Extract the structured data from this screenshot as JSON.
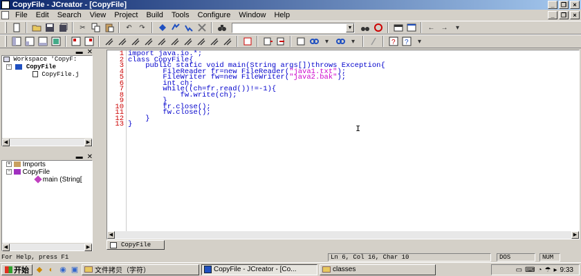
{
  "window": {
    "title": "CopyFile - JCreator - [CopyFile]"
  },
  "menu": [
    "File",
    "Edit",
    "Search",
    "View",
    "Project",
    "Build",
    "Tools",
    "Configure",
    "Window",
    "Help"
  ],
  "workspace": {
    "root": "Workspace 'CopyF:",
    "project": "CopyFile",
    "file": "CopyFile.j"
  },
  "class_view": {
    "imports": "Imports",
    "class": "CopyFile",
    "method": "main (String["
  },
  "editor": {
    "line_numbers": [
      "1",
      "2",
      "3",
      "4",
      "5",
      "6",
      "7",
      "8",
      "9",
      "10",
      "11",
      "12",
      "13"
    ],
    "lines": [
      "import java.io.*;",
      "class CopyFile{",
      "    public static void main(String args[])throws Exception{",
      "        FileReader fr=new FileReader(\"java1.txt\");",
      "        FileWriter fw=new FileWriter(\"java2.bak\");",
      "        int ch;",
      "        while((ch=fr.read())!=-1){",
      "            fw.write(ch);",
      "        }",
      "        fr.close();",
      "        fw.close();",
      "    }",
      "}"
    ],
    "tab": "CopyFile"
  },
  "status": {
    "help": "For Help, press F1",
    "position": "Ln 6, Col 16, Char 10",
    "mode": "DOS",
    "num": "NUM"
  },
  "taskbar": {
    "start": "开始",
    "tasks": [
      "文件拷贝（字符）",
      "CopyFile - JCreator - [Co...",
      "classes"
    ],
    "clock": "9:33"
  }
}
